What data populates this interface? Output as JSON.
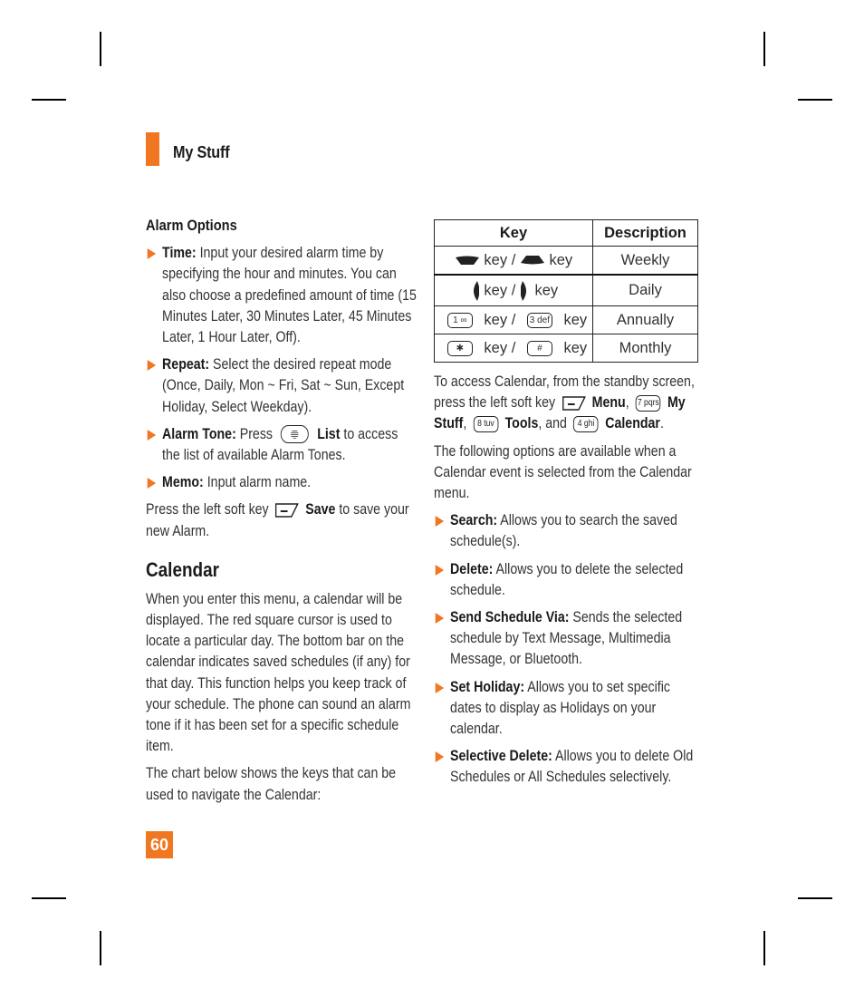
{
  "section": {
    "title": "My Stuff"
  },
  "alarm_options": {
    "heading": "Alarm Options",
    "items": [
      {
        "term": "Time:",
        "text": " Input your desired alarm time by specifying the hour and minutes. You can also choose a predefined amount of time (15 Minutes Later, 30 Minutes Later, 45 Minutes Later, 1 Hour Later, Off)."
      },
      {
        "term": "Repeat:",
        "text": " Select the desired repeat mode (Once, Daily, Mon ~ Fri, Sat ~ Sun, Except Holiday, Select Weekday)."
      },
      {
        "term": "Alarm Tone:",
        "text_before": " Press",
        "key_label": "List",
        "text_after": " to access the list of available Alarm Tones."
      },
      {
        "term": "Memo:",
        "text": " Input alarm name."
      }
    ],
    "save_note": {
      "before": "Press the left soft key",
      "key_label": "Save",
      "after": " to save your new Alarm."
    }
  },
  "calendar": {
    "heading": "Calendar",
    "intro": "When you enter this menu, a calendar will be displayed. The red square cursor is used to locate a particular day. The bottom bar on the calendar indicates saved schedules (if any) for that day. This function helps you keep track of your schedule. The phone can sound an alarm tone if it has been set for a specific schedule item.",
    "chart_intro": "The chart below shows the keys that can be used to navigate the Calendar:",
    "table": {
      "headers": [
        "Key",
        "Description"
      ],
      "key_word": "key",
      "separator": "/",
      "rows": [
        {
          "key1_icon": "nav-up-key",
          "key2_icon": "nav-down-key",
          "description": "Weekly"
        },
        {
          "key1_icon": "nav-left-key",
          "key2_icon": "nav-right-key",
          "description": "Daily"
        },
        {
          "key1_icon": "key-1",
          "key1_label": "1 ∞",
          "key2_icon": "key-3",
          "key2_label": "3 def",
          "description": "Annually"
        },
        {
          "key1_icon": "key-star",
          "key1_label": "✱",
          "key2_icon": "key-hash",
          "key2_label": "#",
          "description": "Monthly"
        }
      ]
    },
    "access": {
      "t1": "To access Calendar, from the standby screen, press the left soft key",
      "menu": "Menu",
      "comma": ",",
      "key7": "7 pqrs",
      "mystuff": "My Stuff",
      "key8": "8 tuv",
      "tools": "Tools",
      "and": ", and",
      "key4": "4 ghi",
      "cal": "Calendar",
      "period": "."
    },
    "options_intro": "The following options are available when a Calendar event is selected from the Calendar menu.",
    "options": [
      {
        "term": "Search:",
        "text": " Allows you to search the saved schedule(s)."
      },
      {
        "term": "Delete:",
        "text": " Allows you to delete the selected schedule."
      },
      {
        "term": "Send Schedule Via:",
        "text": " Sends the selected schedule by Text Message, Multimedia Message, or Bluetooth."
      },
      {
        "term": "Set Holiday:",
        "text": " Allows you to set specific dates to display as Holidays on your calendar."
      },
      {
        "term": "Selective Delete:",
        "text": " Allows you to delete Old Schedules or All Schedules selectively."
      }
    ]
  },
  "page_number": "60",
  "colors": {
    "accent": "#f07622",
    "text": "#333333"
  }
}
